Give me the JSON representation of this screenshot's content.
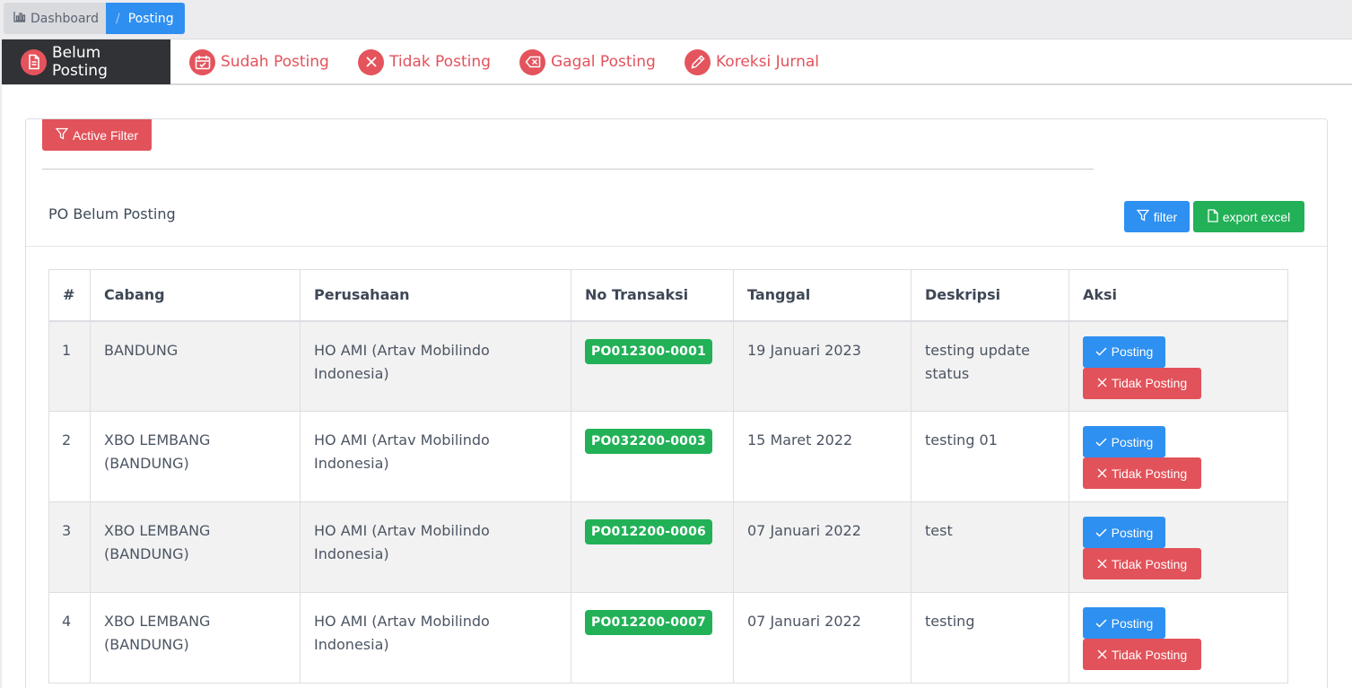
{
  "breadcrumb": {
    "dashboard": "Dashboard",
    "separator": "/",
    "current": "Posting"
  },
  "tabs": [
    {
      "label": "Belum Posting",
      "icon": "document-icon",
      "active": true
    },
    {
      "label": "Sudah Posting",
      "icon": "calendar-check-icon",
      "active": false
    },
    {
      "label": "Tidak Posting",
      "icon": "close-icon",
      "active": false
    },
    {
      "label": "Gagal Posting",
      "icon": "backspace-icon",
      "active": false
    },
    {
      "label": "Koreksi Jurnal",
      "icon": "pencil-icon",
      "active": false
    }
  ],
  "toolbar": {
    "active_filter_label": "Active Filter",
    "filter_label": "filter",
    "export_label": "export excel"
  },
  "card": {
    "title": "PO Belum Posting"
  },
  "table": {
    "headers": [
      "#",
      "Cabang",
      "Perusahaan",
      "No Transaksi",
      "Tanggal",
      "Deskripsi",
      "Aksi"
    ],
    "rows": [
      {
        "num": "1",
        "cabang": "BANDUNG",
        "perusahaan": "HO AMI (Artav Mobilindo Indonesia)",
        "no_transaksi": "PO012300-0001",
        "tanggal": "19 Januari 2023",
        "deskripsi": "testing update status"
      },
      {
        "num": "2",
        "cabang": "XBO LEMBANG (BANDUNG)",
        "perusahaan": "HO AMI (Artav Mobilindo Indonesia)",
        "no_transaksi": "PO032200-0003",
        "tanggal": "15 Maret 2022",
        "deskripsi": "testing 01"
      },
      {
        "num": "3",
        "cabang": "XBO LEMBANG (BANDUNG)",
        "perusahaan": "HO AMI (Artav Mobilindo Indonesia)",
        "no_transaksi": "PO012200-0006",
        "tanggal": "07 Januari 2022",
        "deskripsi": "test"
      },
      {
        "num": "4",
        "cabang": "XBO LEMBANG (BANDUNG)",
        "perusahaan": "HO AMI (Artav Mobilindo Indonesia)",
        "no_transaksi": "PO012200-0007",
        "tanggal": "07 Januari 2022",
        "deskripsi": "testing"
      }
    ],
    "posting_label": "Posting",
    "tidak_posting_label": "Tidak Posting"
  },
  "colors": {
    "accent_blue": "#2e90f0",
    "danger_red": "#e2525a",
    "success_green": "#22b157",
    "dark_tab": "#303236"
  }
}
